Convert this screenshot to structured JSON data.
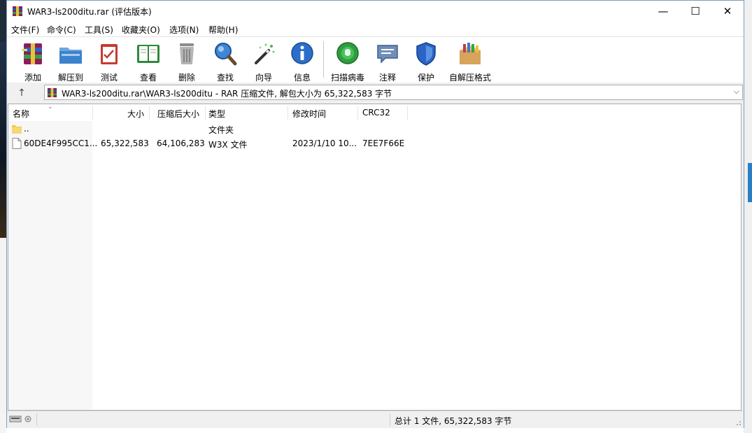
{
  "window": {
    "title": "WAR3-ls200ditu.rar (评估版本)",
    "controls": {
      "minimize": "—",
      "maximize": "☐",
      "close": "✕"
    }
  },
  "menu": [
    {
      "label": "文件(F)"
    },
    {
      "label": "命令(C)"
    },
    {
      "label": "工具(S)"
    },
    {
      "label": "收藏夹(O)"
    },
    {
      "label": "选项(N)"
    },
    {
      "label": "帮助(H)"
    }
  ],
  "toolbar": [
    {
      "label": "添加",
      "icon": "add-archive-icon"
    },
    {
      "label": "解压到",
      "icon": "extract-to-icon"
    },
    {
      "label": "测试",
      "icon": "test-icon"
    },
    {
      "label": "查看",
      "icon": "view-book-icon"
    },
    {
      "label": "删除",
      "icon": "trash-icon"
    },
    {
      "label": "查找",
      "icon": "magnifier-icon"
    },
    {
      "label": "向导",
      "icon": "wizard-wand-icon"
    },
    {
      "label": "信息",
      "icon": "info-icon"
    },
    {
      "label": "扫描病毒",
      "icon": "virus-scan-icon"
    },
    {
      "label": "注释",
      "icon": "comment-icon"
    },
    {
      "label": "保护",
      "icon": "shield-icon"
    },
    {
      "label": "自解压格式",
      "icon": "sfx-box-icon"
    }
  ],
  "address": {
    "path": "WAR3-ls200ditu.rar\\WAR3-ls200ditu - RAR 压缩文件, 解包大小为 65,322,583 字节"
  },
  "columns": {
    "name": "名称",
    "size": "大小",
    "packed": "压缩后大小",
    "type": "类型",
    "modified": "修改时间",
    "crc": "CRC32"
  },
  "files": [
    {
      "name": "..",
      "size": "",
      "packed": "",
      "type": "文件夹",
      "modified": "",
      "crc": ""
    },
    {
      "name": "60DE4F995CC1...",
      "size": "65,322,583",
      "packed": "64,106,283",
      "type": "W3X 文件",
      "modified": "2023/1/10 10...",
      "crc": "7EE7F66E"
    }
  ],
  "status": {
    "summary": "总计 1 文件, 65,322,583 字节"
  },
  "colors": {
    "accent": "#2a7fc4",
    "border": "#abadb3"
  }
}
